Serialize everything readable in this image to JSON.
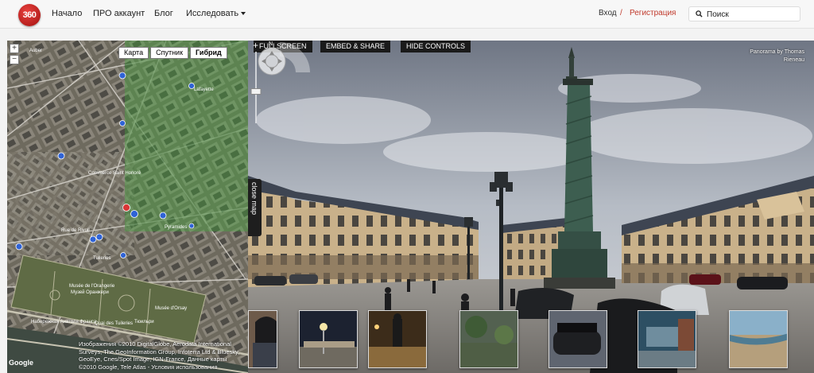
{
  "header": {
    "logo_text": "360",
    "nav": [
      {
        "label": "Начало"
      },
      {
        "label": "ПРО аккаунт"
      },
      {
        "label": "Блог"
      },
      {
        "label": "Исследовать"
      }
    ],
    "login": "Вход",
    "separator": "/",
    "register": "Регистрация",
    "search_placeholder": "Поиск",
    "accent_color": "#c0392b"
  },
  "map": {
    "types": [
      {
        "label": "Карта",
        "active": false
      },
      {
        "label": "Спутник",
        "active": false
      },
      {
        "label": "Гибрид",
        "active": true
      }
    ],
    "zoom_in": "+",
    "zoom_out": "−",
    "labels": [
      {
        "text": "Lafayette"
      },
      {
        "text": "Auber"
      },
      {
        "text": "Commerce Saint Honoré"
      },
      {
        "text": "Pyramides"
      },
      {
        "text": "Tuileries"
      },
      {
        "text": "Musée de l'Orangerie"
      },
      {
        "text": "Musée d'Orsay"
      },
      {
        "text": "Quai des Tuileries"
      },
      {
        "text": "Музей Оранжери"
      },
      {
        "text": "Тюильри"
      },
      {
        "text": "Rue de Rivoli"
      },
      {
        "text": "Набережная Анатоля Франса"
      }
    ],
    "copyright": "Изображения ©2010 DigitalGlobe, Aerodata International Surveys, The GeoInformation Group, Infoterra Ltd & Bluesky, GeoEye, Cnes/Spot Image, IGN-France, Данные карты ©2010 Google, Tele Atlas - Условия использования",
    "google_logo": "Google",
    "close_map_label": "close map",
    "overlay_color": "#3fae3a"
  },
  "pano": {
    "buttons": [
      "FULLSCREEN",
      "EMBED & SHARE",
      "HIDE CONTROLS"
    ],
    "credit": "Panorama by Thomas Rieneau",
    "compass_north": "N",
    "zoom_plus": "+",
    "zoom_level": 0.45,
    "thumbnails": [
      {
        "name": "thumb-night-street"
      },
      {
        "name": "thumb-woman-night"
      },
      {
        "name": "thumb-green-park"
      },
      {
        "name": "thumb-cars"
      },
      {
        "name": "thumb-aquarium"
      },
      {
        "name": "thumb-beach"
      }
    ]
  }
}
